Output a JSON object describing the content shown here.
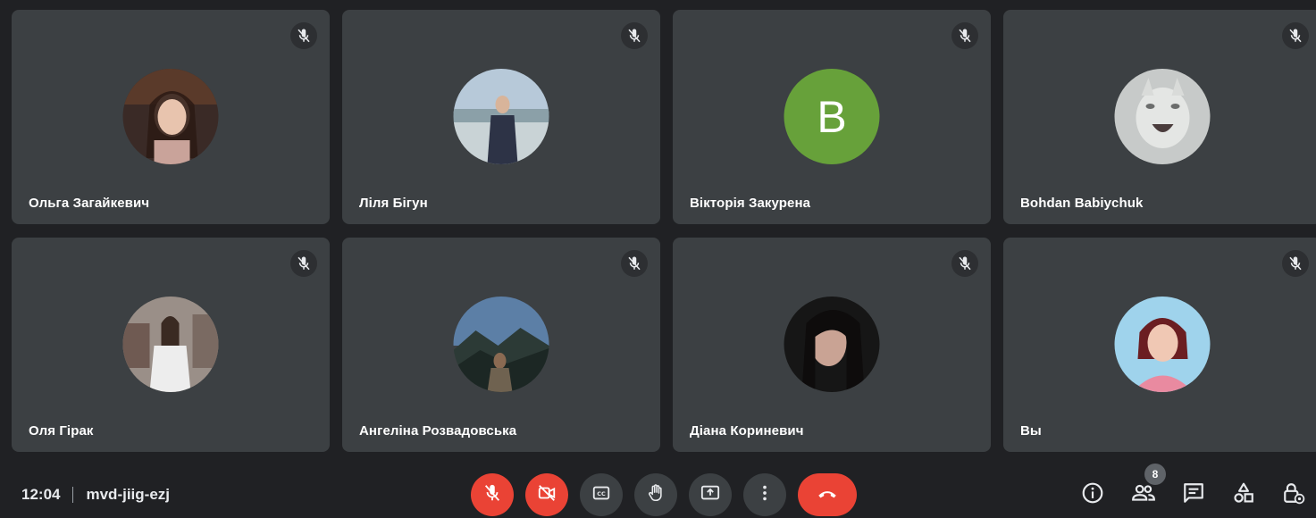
{
  "participants": [
    {
      "name": "Ольга Загайкевич"
    },
    {
      "name": "Ліля Бігун"
    },
    {
      "name": "Вікторія Закурена",
      "initial": "B"
    },
    {
      "name": "Bohdan Babiychuk"
    },
    {
      "name": "Оля Гірак"
    },
    {
      "name": "Ангеліна Розвадовська"
    },
    {
      "name": "Діана Кориневич"
    },
    {
      "name": "Вы"
    }
  ],
  "meeting": {
    "time": "12:04",
    "code": "mvd-jiig-ezj",
    "participant_count": "8"
  },
  "icons": {
    "tile_status": "mic-off-icon",
    "controls": [
      "mic-off-icon",
      "camera-off-icon",
      "captions-icon",
      "raise-hand-icon",
      "present-screen-icon",
      "more-options-icon",
      "hang-up-icon"
    ],
    "side": [
      "info-icon",
      "people-icon",
      "chat-icon",
      "activities-icon",
      "host-controls-icon"
    ]
  },
  "colors": {
    "background": "#202124",
    "tile": "#3c4043",
    "danger": "#ea4335",
    "letter_avatar": "#67a13a"
  }
}
